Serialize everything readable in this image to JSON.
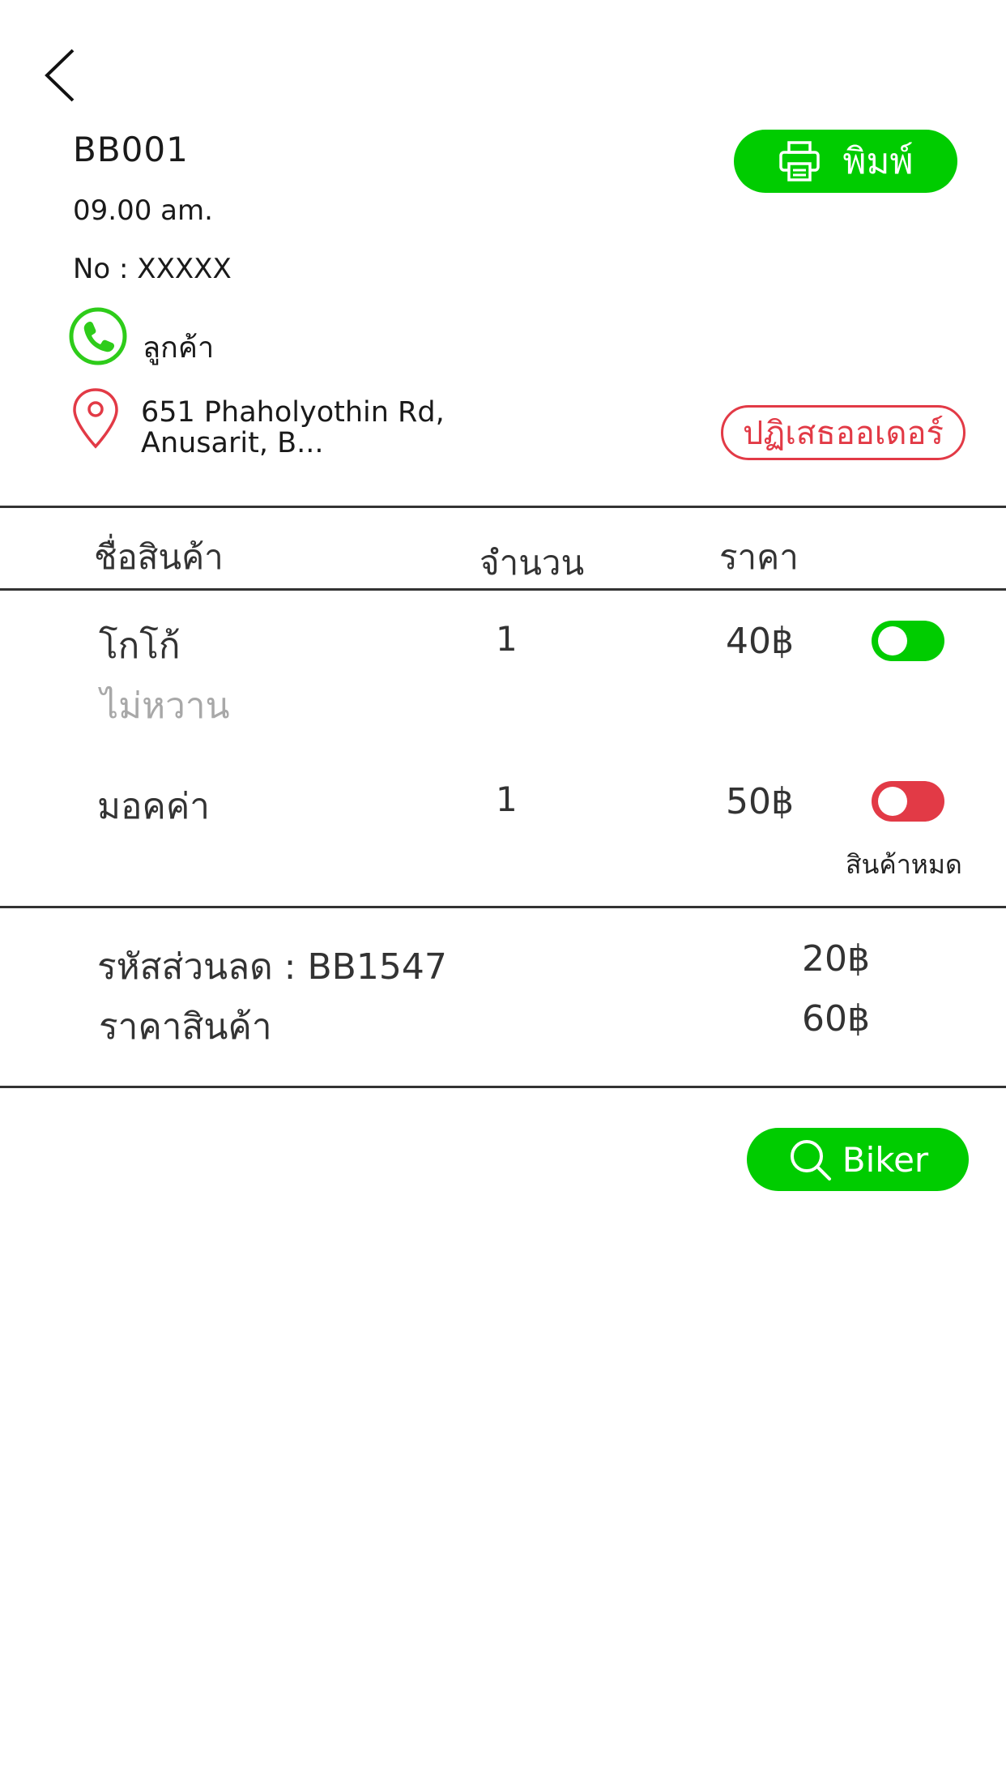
{
  "header": {
    "order_id": "BB001",
    "time": "09.00 am.",
    "order_no": "No : XXXXX",
    "customer_label": "ลูกค้า",
    "address_line1": "651 Phaholyothin Rd,",
    "address_line2": "Anusarit, B..."
  },
  "actions": {
    "print_label": "พิมพ์",
    "reject_label": "ปฏิเสธออเดอร์",
    "biker_label": "Biker"
  },
  "table": {
    "headers": {
      "name": "ชื่อสินค้า",
      "qty": "จำนวน",
      "price": "ราคา"
    },
    "items": [
      {
        "name": "โกโก้",
        "note": "ไม่หวาน",
        "qty": "1",
        "price": "40฿",
        "available": true
      },
      {
        "name": "มอคค่า",
        "note": "",
        "qty": "1",
        "price": "50฿",
        "available": false,
        "status": "สินค้าหมด"
      }
    ]
  },
  "summary": {
    "discount_label": "รหัสส่วนลด : BB1547",
    "discount_value": "20฿",
    "subtotal_label": "ราคาสินค้า",
    "subtotal_value": "60฿"
  },
  "icons": {
    "back": "chevron-left-icon",
    "phone": "phone-icon",
    "location": "map-pin-icon",
    "print": "printer-icon",
    "search": "search-icon"
  },
  "colors": {
    "green": "#00cc00",
    "red": "#e23a46",
    "phone_green": "#2ecc1a"
  }
}
